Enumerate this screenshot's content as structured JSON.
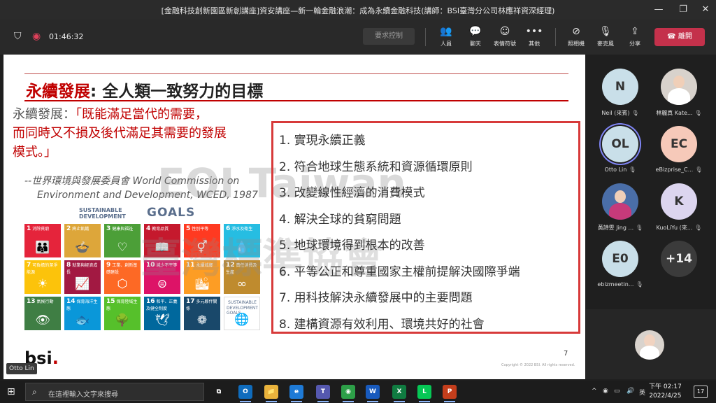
{
  "window": {
    "title": "[金融科技創新園區新創講座]資安講座—新一輪金融浪潮：成為永續金融科技(講師：BSI臺灣分公司林應祥資深經理)",
    "controls": [
      "minimize-icon",
      "restore-icon",
      "close-icon"
    ]
  },
  "toolbar": {
    "timer": "01:46:32",
    "request_control": "要求控制",
    "tools": [
      {
        "label": "人員",
        "icon": "people-icon"
      },
      {
        "label": "聊天",
        "icon": "chat-icon"
      },
      {
        "label": "表情符號",
        "icon": "reactions-icon"
      },
      {
        "label": "其他",
        "icon": "more-icon"
      },
      {
        "label": "照相機",
        "icon": "camera-off-icon"
      },
      {
        "label": "麥克風",
        "icon": "mic-off-icon"
      },
      {
        "label": "分享",
        "icon": "share-icon"
      }
    ],
    "leave": "離開",
    "colors": {
      "leave": "#c4314b"
    }
  },
  "slide": {
    "title_red": "永續發展",
    "title_black": ": 全人類一致努力的目標",
    "quote_prefix": "永續發展：",
    "quote_line1": "「既能滿足當代的需要，",
    "quote_line2": "而同時又不損及後代滿足其需要的發展",
    "quote_line3": "模式。」",
    "attribution_line1": "--世界環境與發展委員會 World Commission on",
    "attribution_line2": "Environment and Development, WCED, 1987",
    "sdg_header_line1": "SUSTAINABLE",
    "sdg_header_line2": "DEVELOPMENT",
    "sdg_goals_word": "GOALS",
    "sdg_tiles": [
      {
        "num": "1",
        "label": "消除貧窮",
        "color": "#e5243b",
        "glyph": "👪"
      },
      {
        "num": "2",
        "label": "終止飢餓",
        "color": "#dda63a",
        "glyph": "🍲"
      },
      {
        "num": "3",
        "label": "健康與福祉",
        "color": "#4c9f38",
        "glyph": "♡"
      },
      {
        "num": "4",
        "label": "教育品質",
        "color": "#c5192d",
        "glyph": "📖"
      },
      {
        "num": "5",
        "label": "性別平等",
        "color": "#ff3a21",
        "glyph": "⚥"
      },
      {
        "num": "6",
        "label": "淨水及衛生",
        "color": "#26bde2",
        "glyph": "💧"
      },
      {
        "num": "7",
        "label": "可負擔的潔淨能源",
        "color": "#fcc30b",
        "glyph": "☀"
      },
      {
        "num": "8",
        "label": "就業與經濟成長",
        "color": "#a21942",
        "glyph": "📈"
      },
      {
        "num": "9",
        "label": "工業、創新基礎建設",
        "color": "#fd6925",
        "glyph": "⬡"
      },
      {
        "num": "10",
        "label": "減少不平等",
        "color": "#dd1367",
        "glyph": "⊜"
      },
      {
        "num": "11",
        "label": "永續城鄉",
        "color": "#fd9d24",
        "glyph": "🏙"
      },
      {
        "num": "12",
        "label": "責任消費及生產",
        "color": "#bf8b2e",
        "glyph": "∞"
      },
      {
        "num": "13",
        "label": "氣候行動",
        "color": "#3f7e44",
        "glyph": "👁"
      },
      {
        "num": "14",
        "label": "保育海洋生態",
        "color": "#0a97d9",
        "glyph": "🐟"
      },
      {
        "num": "15",
        "label": "保育陸域生態",
        "color": "#56c02b",
        "glyph": "🌳"
      },
      {
        "num": "16",
        "label": "和平、正義及健全制度",
        "color": "#00689d",
        "glyph": "🕊"
      },
      {
        "num": "17",
        "label": "多元夥伴關係",
        "color": "#19486a",
        "glyph": "❁"
      },
      {
        "num": "",
        "label": "SUSTAINABLE DEVELOPMENT GOALS",
        "color": "#ffffff",
        "glyph": "🌐"
      }
    ],
    "goals": [
      "1. 實現永續正義",
      "2. 符合地球生態系統和資源循環原則",
      "3. 改變線性經濟的消費模式",
      "4. 解決全球的貧窮問題",
      "5. 地球環境得到根本的改善",
      "6. 平等公正和尊重國家主權前提解決國際爭端",
      "7. 用科技解決永續發展中的主要問題",
      "8. 建構資源有效利用、環境共好的社會"
    ],
    "watermark_line1": "EOI Taiwan",
    "watermark_line2": "臺灣標準協會",
    "logo_text": "bsi",
    "logo_dot": ".",
    "page_number": "7",
    "copyright": "Copyright © 2022 BSI. All rights reserved.",
    "presenter_tag": "Otto Lin"
  },
  "participants": [
    {
      "initials": "N",
      "name": "Neil (來賓)",
      "bg": "#c9dfe9",
      "fg": "#333"
    },
    {
      "initials": "",
      "name": "林麗真 Kate...",
      "bg": "#d8d2cc",
      "fg": "#333",
      "photo": true
    },
    {
      "initials": "OL",
      "name": "Otto Lin",
      "bg": "#c9dfe9",
      "fg": "#333",
      "ring": true
    },
    {
      "initials": "EC",
      "name": "eBizprise_C...",
      "bg": "#f6c9b9",
      "fg": "#333"
    },
    {
      "initials": "",
      "name": "黃詩雯 Jing ...",
      "bg": "#4a6ea8",
      "fg": "#fff",
      "photo": true
    },
    {
      "initials": "K",
      "name": "KuoLiYu (來...",
      "bg": "#dcd5ef",
      "fg": "#333"
    },
    {
      "initials": "E0",
      "name": "ebizmeetin...",
      "bg": "#c9dfe9",
      "fg": "#333"
    },
    {
      "initials": "+14",
      "name": "",
      "bg": "#3b3b3b",
      "fg": "#eee"
    }
  ],
  "taskbar": {
    "search_placeholder": "在這裡輸入文字來搜尋",
    "apps": [
      {
        "name": "task-view",
        "label": "⧉",
        "color": "#1c1c1c"
      },
      {
        "name": "outlook",
        "label": "O",
        "color": "#0f6cbd"
      },
      {
        "name": "file-explorer",
        "label": "📁",
        "color": "#e9b33c"
      },
      {
        "name": "edge",
        "label": "e",
        "color": "#1e7ad6"
      },
      {
        "name": "teams",
        "label": "T",
        "color": "#5558af"
      },
      {
        "name": "chrome",
        "label": "◉",
        "color": "#2d9f48"
      },
      {
        "name": "word",
        "label": "W",
        "color": "#185abd"
      },
      {
        "name": "excel",
        "label": "X",
        "color": "#107c41"
      },
      {
        "name": "line",
        "label": "L",
        "color": "#06c755"
      },
      {
        "name": "powerpoint",
        "label": "P",
        "color": "#c43e1c"
      }
    ],
    "ime": "英",
    "time": "下午 02:17",
    "date": "2022/4/25",
    "notifications": "17"
  }
}
